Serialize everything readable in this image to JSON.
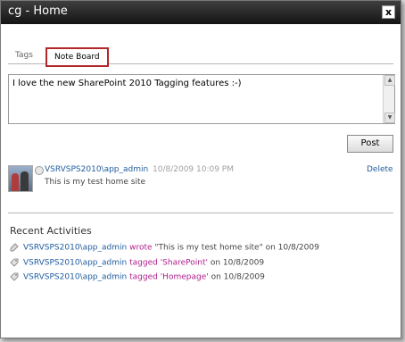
{
  "window": {
    "title": "cg - Home",
    "close_glyph": "x"
  },
  "tabs": [
    {
      "label": "Tags"
    },
    {
      "label": "Note Board"
    }
  ],
  "note_input": {
    "value": "I love the new SharePoint 2010 Tagging features :-)"
  },
  "post_button": {
    "label": "Post"
  },
  "note": {
    "user": "VSRVSPS2010\\app_admin",
    "date": "10/8/2009 10:09 PM",
    "delete_label": "Delete",
    "message": "This is my test home site"
  },
  "recent": {
    "title": "Recent Activities",
    "items": [
      {
        "user": "VSRVSPS2010\\app_admin",
        "action": "wrote",
        "pre": "\"This is my test home site\"",
        "post": " on 10/8/2009",
        "icon": "note-icon"
      },
      {
        "user": "VSRVSPS2010\\app_admin",
        "action": "tagged",
        "pre": "'SharePoint'",
        "post": " on 10/8/2009",
        "icon": "tag-icon"
      },
      {
        "user": "VSRVSPS2010\\app_admin",
        "action": "tagged",
        "pre": "'Homepage'",
        "post": " on 10/8/2009",
        "icon": "tag-icon"
      }
    ]
  },
  "colors": {
    "link": "#1f5c9e",
    "action": "#b01d8c",
    "highlight_border": "#b2272a"
  }
}
